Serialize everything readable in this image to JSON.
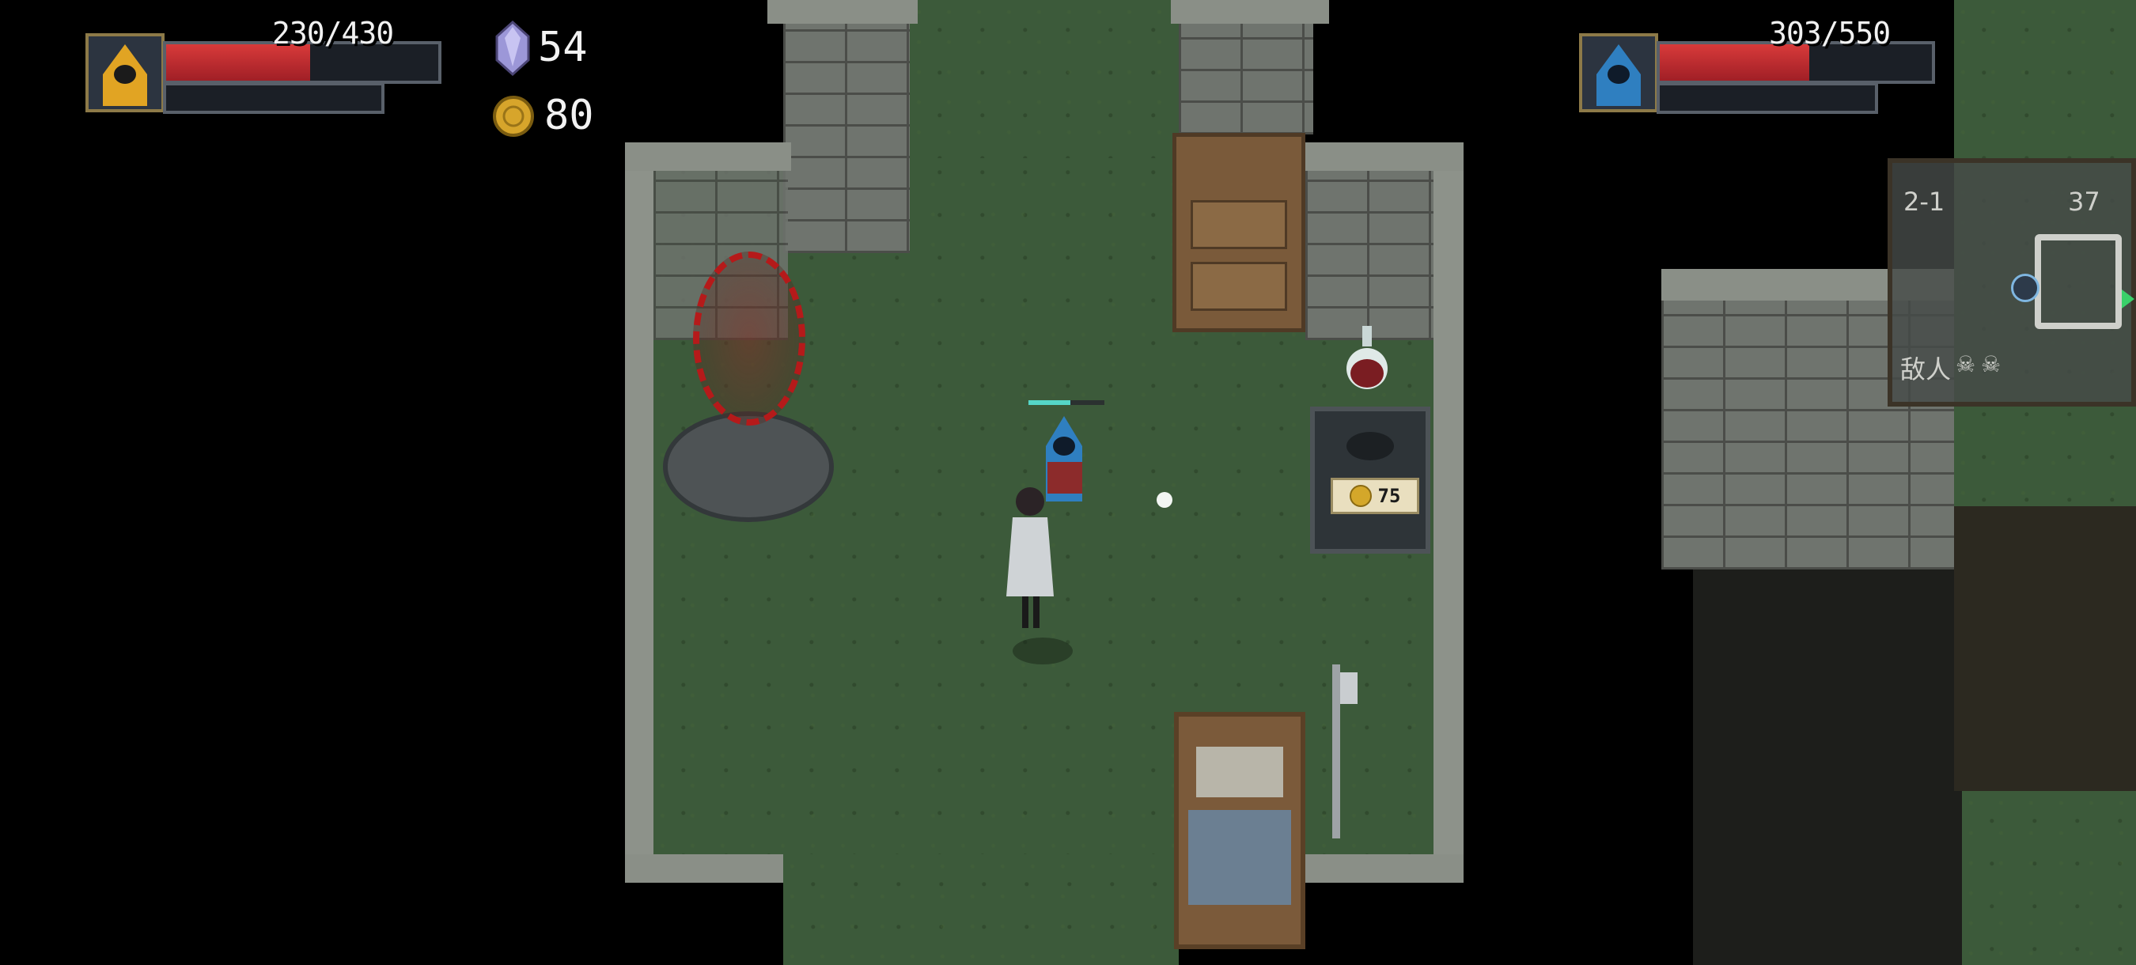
{
  "player1": {
    "hp_text": "230/430",
    "hp_fraction": 0.53,
    "mana_fraction": 0.0,
    "portrait_icon": "yellow-hooded-character-icon"
  },
  "player2": {
    "hp_text": "303/550",
    "hp_fraction": 0.55,
    "mana_fraction": 0.0,
    "portrait_icon": "blue-hooded-character-icon"
  },
  "resources": {
    "crystals": "54",
    "gold": "80",
    "crystal_icon": "purple-crystal-icon",
    "gold_icon": "gold-coin-icon"
  },
  "shop": {
    "price": "75",
    "coin_icon": "coin-icon"
  },
  "minimap": {
    "level": "2-1",
    "percent": "37",
    "enemies_label": "敌人",
    "enemy_icon": "skull-icon"
  },
  "colors": {
    "hp_red": "#c72b30",
    "frame_gold": "#8d7a48",
    "floor_green": "#3c5a3a"
  }
}
